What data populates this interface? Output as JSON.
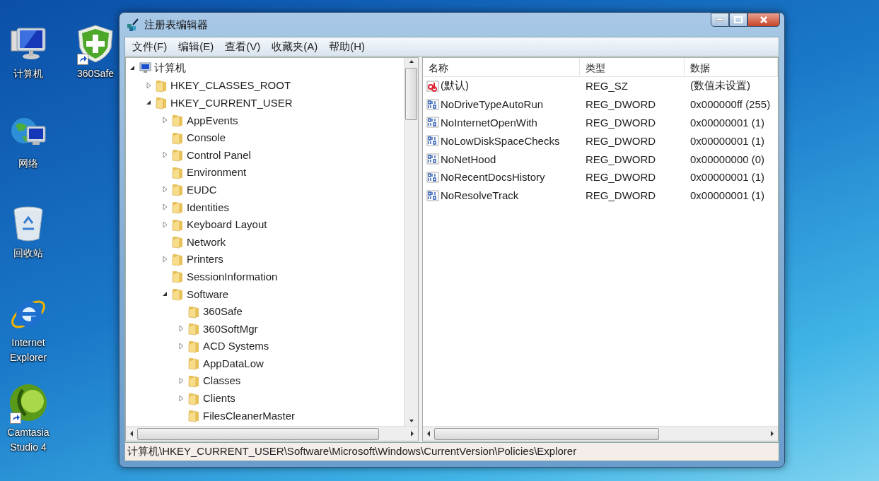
{
  "desktop": {
    "icons": [
      {
        "label": "计算机",
        "kind": "computer",
        "shortcut": false
      },
      {
        "label": "网络",
        "kind": "network",
        "shortcut": false
      },
      {
        "label": "回收站",
        "kind": "recycle-bin",
        "shortcut": false
      },
      {
        "label": "Internet Explorer",
        "kind": "browser",
        "shortcut": false
      },
      {
        "label": "Camtasia Studio 4",
        "kind": "camtasia",
        "shortcut": true
      },
      {
        "label": "360Safe",
        "kind": "shield",
        "shortcut": true
      }
    ]
  },
  "window": {
    "title": "注册表编辑器",
    "menu": [
      "文件(F)",
      "编辑(E)",
      "查看(V)",
      "收藏夹(A)",
      "帮助(H)"
    ],
    "tree": [
      {
        "label": "计算机",
        "kind": "computer",
        "expanded": true,
        "children": [
          {
            "label": "HKEY_CLASSES_ROOT",
            "expanded": false
          },
          {
            "label": "HKEY_CURRENT_USER",
            "expanded": true,
            "children": [
              {
                "label": "AppEvents",
                "expanded": false
              },
              {
                "label": "Console"
              },
              {
                "label": "Control Panel",
                "expanded": false
              },
              {
                "label": "Environment"
              },
              {
                "label": "EUDC",
                "expanded": false
              },
              {
                "label": "Identities",
                "expanded": false
              },
              {
                "label": "Keyboard Layout",
                "expanded": false
              },
              {
                "label": "Network"
              },
              {
                "label": "Printers",
                "expanded": false
              },
              {
                "label": "SessionInformation"
              },
              {
                "label": "Software",
                "expanded": true,
                "children": [
                  {
                    "label": "360Safe"
                  },
                  {
                    "label": "360SoftMgr",
                    "expanded": false
                  },
                  {
                    "label": "ACD Systems",
                    "expanded": false
                  },
                  {
                    "label": "AppDataLow"
                  },
                  {
                    "label": "Classes",
                    "expanded": false
                  },
                  {
                    "label": "Clients",
                    "expanded": false
                  },
                  {
                    "label": "FilesCleanerMaster"
                  }
                ]
              }
            ]
          }
        ]
      }
    ],
    "values": {
      "columns": [
        "名称",
        "类型",
        "数据"
      ],
      "rows": [
        {
          "name": "(默认)",
          "type": "REG_SZ",
          "data": "(数值未设置)",
          "kind": "string"
        },
        {
          "name": "NoDriveTypeAutoRun",
          "type": "REG_DWORD",
          "data": "0x000000ff (255)",
          "kind": "binary"
        },
        {
          "name": "NoInternetOpenWith",
          "type": "REG_DWORD",
          "data": "0x00000001 (1)",
          "kind": "binary"
        },
        {
          "name": "NoLowDiskSpaceChecks",
          "type": "REG_DWORD",
          "data": "0x00000001 (1)",
          "kind": "binary"
        },
        {
          "name": "NoNetHood",
          "type": "REG_DWORD",
          "data": "0x00000000 (0)",
          "kind": "binary"
        },
        {
          "name": "NoRecentDocsHistory",
          "type": "REG_DWORD",
          "data": "0x00000001 (1)",
          "kind": "binary"
        },
        {
          "name": "NoResolveTrack",
          "type": "REG_DWORD",
          "data": "0x00000001 (1)",
          "kind": "binary"
        }
      ]
    },
    "status_bar": "计算机\\HKEY_CURRENT_USER\\Software\\Microsoft\\Windows\\CurrentVersion\\Policies\\Explorer"
  }
}
